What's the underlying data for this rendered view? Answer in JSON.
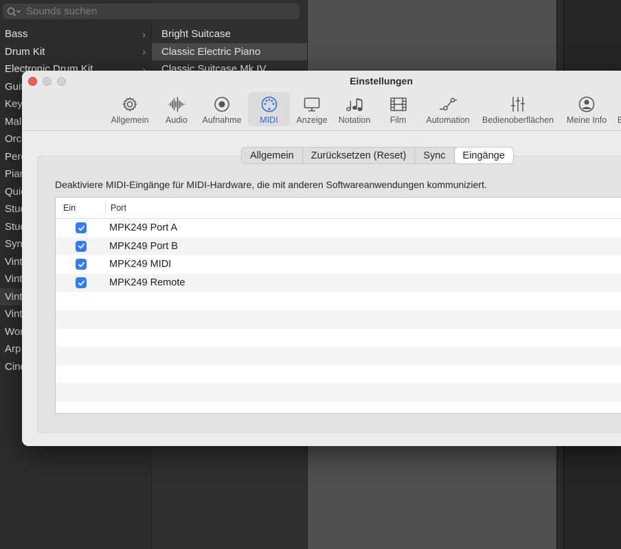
{
  "library": {
    "search_placeholder": "Sounds suchen",
    "categories": [
      {
        "label": "Bass"
      },
      {
        "label": "Drum Kit"
      },
      {
        "label": "Electronic Drum Kit"
      },
      {
        "label": "Guit"
      },
      {
        "label": "Key"
      },
      {
        "label": "Mall"
      },
      {
        "label": "Orc"
      },
      {
        "label": "Perc"
      },
      {
        "label": "Pian"
      },
      {
        "label": "Quic"
      },
      {
        "label": "Stud"
      },
      {
        "label": "Stud"
      },
      {
        "label": "Syn"
      },
      {
        "label": "Vint"
      },
      {
        "label": "Vint"
      },
      {
        "label": "Vint"
      },
      {
        "label": "Vint"
      },
      {
        "label": "Wor"
      },
      {
        "label": "Arp"
      },
      {
        "label": "Cine"
      }
    ],
    "patches": [
      {
        "label": "Bright Suitcase"
      },
      {
        "label": "Classic Electric Piano"
      },
      {
        "label": "Classic Suitcase Mk IV"
      }
    ]
  },
  "window": {
    "title": "Einstellungen",
    "toolbar": [
      {
        "label": "Allgemein",
        "icon": "gear-icon"
      },
      {
        "label": "Audio",
        "icon": "waveform-icon"
      },
      {
        "label": "Aufnahme",
        "icon": "record-icon"
      },
      {
        "label": "MIDI",
        "icon": "midi-port-icon"
      },
      {
        "label": "Anzeige",
        "icon": "display-icon"
      },
      {
        "label": "Notation",
        "icon": "notes-icon"
      },
      {
        "label": "Film",
        "icon": "film-icon"
      },
      {
        "label": "Automation",
        "icon": "automation-icon"
      },
      {
        "label": "Bedienoberflächen",
        "icon": "sliders-icon"
      },
      {
        "label": "Meine Info",
        "icon": "person-icon"
      },
      {
        "label": "E",
        "icon": ""
      }
    ],
    "active_tab": "MIDI",
    "accent": "#2a6fd8"
  },
  "midi": {
    "subtabs": [
      {
        "label": "Allgemein"
      },
      {
        "label": "Zurücksetzen (Reset)"
      },
      {
        "label": "Sync"
      },
      {
        "label": "Eingänge"
      }
    ],
    "active_subtab": "Eingänge",
    "description": "Deaktiviere MIDI-Eingänge für MIDI-Hardware, die mit anderen Softwareanwendungen kommuniziert.",
    "table": {
      "col_enabled": "Ein",
      "col_port": "Port",
      "rows": [
        {
          "enabled": true,
          "port": "MPK249 Port A"
        },
        {
          "enabled": true,
          "port": "MPK249 Port B"
        },
        {
          "enabled": true,
          "port": "MPK249 MIDI"
        },
        {
          "enabled": true,
          "port": "MPK249 Remote"
        }
      ]
    }
  }
}
